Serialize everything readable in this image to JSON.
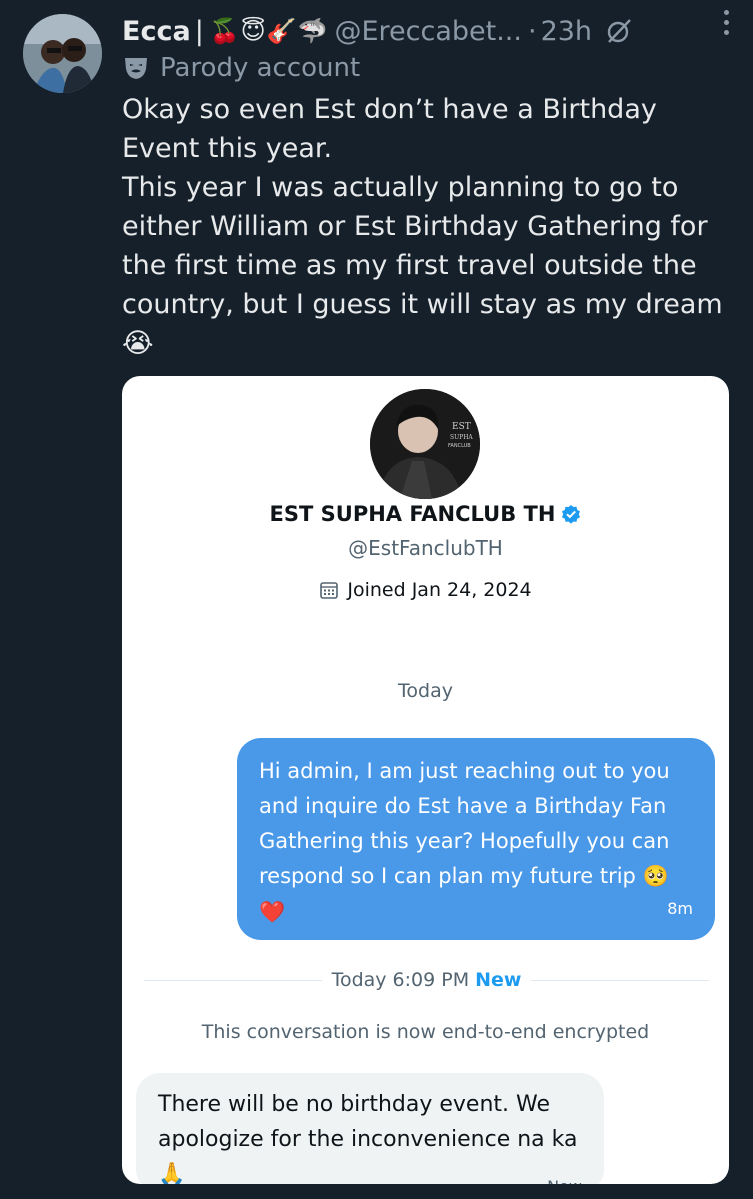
{
  "tweet": {
    "author_name": "Ecca",
    "separator": "|",
    "name_emojis": "🍒😇🎸🦈",
    "handle": "@Ereccabet...",
    "time_sep": "·",
    "time": "23h",
    "label": "Parody account",
    "text_lines": [
      "Okay so even Est don’t have a Birthday Event this year.",
      "This year I was actually planning to go to either William or Est Birthday Gathering for the first time as my first travel outside the country, but I guess it will stay as my dream 😭"
    ]
  },
  "dm": {
    "name": "EST SUPHA FANCLUB TH",
    "handle": "@EstFanclubTH",
    "joined": "Joined Jan 24, 2024",
    "day_label": "Today",
    "outgoing": {
      "text": "Hi admin, I am just reaching out to you and inquire do Est have a Birthday Fan Gathering this year? Hopefully you can respond so I can plan my future trip 🥺",
      "heart": "❤️",
      "time": "8m"
    },
    "divider": {
      "time": "Today 6:09 PM",
      "new": "New"
    },
    "encrypted_notice": "This conversation is now end-to-end encrypted",
    "incoming": {
      "text": "There will be no birthday event. We apologize for the inconvenience na ka 🙏",
      "time": "Now"
    }
  },
  "colors": {
    "background": "#15202b",
    "card": "#ffffff",
    "outgoing_bubble": "#4a99e9",
    "incoming_bubble": "#eff3f4",
    "verified": "#1d9bf0"
  }
}
